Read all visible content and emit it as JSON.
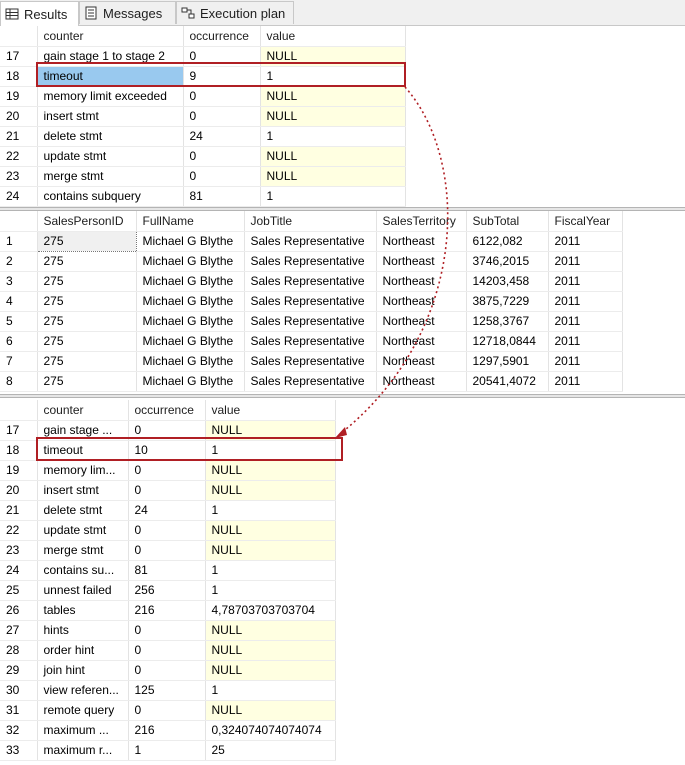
{
  "tabs": [
    {
      "label": "Results",
      "icon": "grid-icon",
      "active": true
    },
    {
      "label": "Messages",
      "icon": "messages-icon",
      "active": false
    },
    {
      "label": "Execution plan",
      "icon": "execution-plan-icon",
      "active": false
    }
  ],
  "grid1": {
    "columns": [
      "counter",
      "occurrence",
      "value"
    ],
    "rows": [
      [
        "17",
        "gain stage 1 to stage 2",
        "0",
        "NULL"
      ],
      [
        "18",
        "timeout",
        "9",
        "1"
      ],
      [
        "19",
        "memory limit exceeded",
        "0",
        "NULL"
      ],
      [
        "20",
        "insert stmt",
        "0",
        "NULL"
      ],
      [
        "21",
        "delete stmt",
        "24",
        "1"
      ],
      [
        "22",
        "update stmt",
        "0",
        "NULL"
      ],
      [
        "23",
        "merge stmt",
        "0",
        "NULL"
      ],
      [
        "24",
        "contains subquery",
        "81",
        "1"
      ]
    ]
  },
  "grid2": {
    "columns": [
      "SalesPersonID",
      "FullName",
      "JobTitle",
      "SalesTerritory",
      "SubTotal",
      "FiscalYear"
    ],
    "rows": [
      [
        "1",
        "275",
        "Michael G Blythe",
        "Sales Representative",
        "Northeast",
        "6122,082",
        "2011"
      ],
      [
        "2",
        "275",
        "Michael G Blythe",
        "Sales Representative",
        "Northeast",
        "3746,2015",
        "2011"
      ],
      [
        "3",
        "275",
        "Michael G Blythe",
        "Sales Representative",
        "Northeast",
        "14203,458",
        "2011"
      ],
      [
        "4",
        "275",
        "Michael G Blythe",
        "Sales Representative",
        "Northeast",
        "3875,7229",
        "2011"
      ],
      [
        "5",
        "275",
        "Michael G Blythe",
        "Sales Representative",
        "Northeast",
        "1258,3767",
        "2011"
      ],
      [
        "6",
        "275",
        "Michael G Blythe",
        "Sales Representative",
        "Northeast",
        "12718,0844",
        "2011"
      ],
      [
        "7",
        "275",
        "Michael G Blythe",
        "Sales Representative",
        "Northeast",
        "1297,5901",
        "2011"
      ],
      [
        "8",
        "275",
        "Michael G Blythe",
        "Sales Representative",
        "Northeast",
        "20541,4072",
        "2011"
      ]
    ]
  },
  "grid3": {
    "columns": [
      "counter",
      "occurrence",
      "value"
    ],
    "rows": [
      [
        "17",
        "gain stage ...",
        "0",
        "NULL"
      ],
      [
        "18",
        "timeout",
        "10",
        "1"
      ],
      [
        "19",
        "memory lim...",
        "0",
        "NULL"
      ],
      [
        "20",
        "insert stmt",
        "0",
        "NULL"
      ],
      [
        "21",
        "delete stmt",
        "24",
        "1"
      ],
      [
        "22",
        "update stmt",
        "0",
        "NULL"
      ],
      [
        "23",
        "merge stmt",
        "0",
        "NULL"
      ],
      [
        "24",
        "contains su...",
        "81",
        "1"
      ],
      [
        "25",
        "unnest failed",
        "256",
        "1"
      ],
      [
        "26",
        "tables",
        "216",
        "4,78703703703704"
      ],
      [
        "27",
        "hints",
        "0",
        "NULL"
      ],
      [
        "28",
        "order hint",
        "0",
        "NULL"
      ],
      [
        "29",
        "join hint",
        "0",
        "NULL"
      ],
      [
        "30",
        "view referen...",
        "125",
        "1"
      ],
      [
        "31",
        "remote query",
        "0",
        "NULL"
      ],
      [
        "32",
        "maximum ...",
        "216",
        "0,324074074074074"
      ],
      [
        "33",
        "maximum r...",
        "1",
        "25"
      ]
    ]
  },
  "colors": {
    "highlight_border": "#b01f24",
    "null_bg": "#ffffe1",
    "selected_bg": "#99c9ef"
  }
}
